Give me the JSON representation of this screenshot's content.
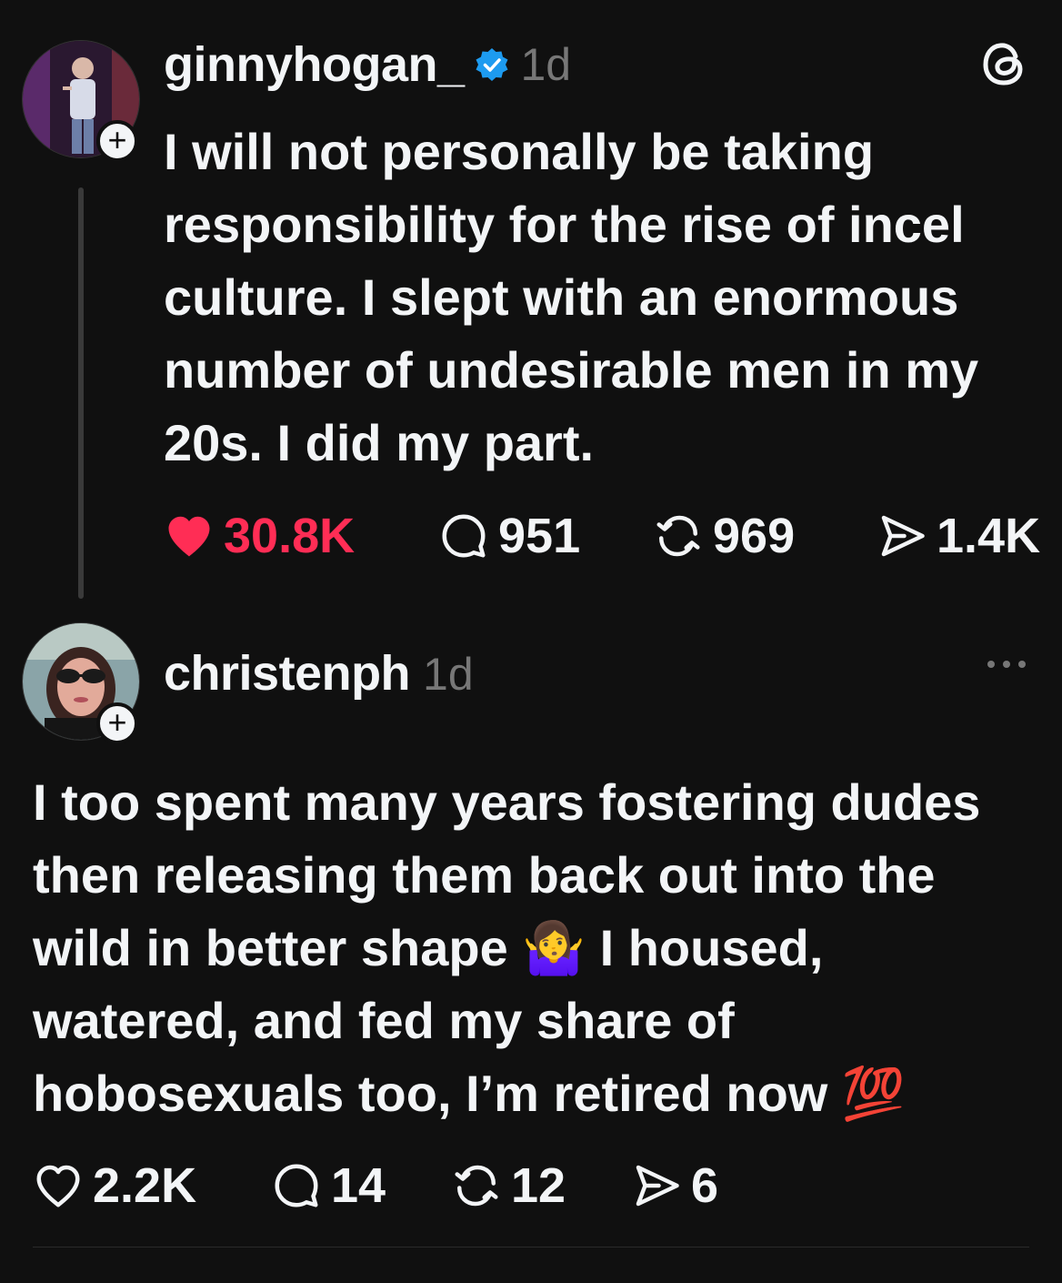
{
  "post": {
    "username": "ginnyhogan_",
    "time": "1d",
    "text": "I will not personally be taking responsibility for the rise of incel culture. I slept with an enormous number of undesirable men in my 20s. I did my part.",
    "likes": "30.8K",
    "replies": "951",
    "reposts": "969",
    "shares": "1.4K",
    "like_color": "#ff2d55"
  },
  "reply": {
    "username": "christenph",
    "time": "1d",
    "text": "I too spent many years fostering dudes then releasing them back out into the wild in better shape 🤷‍♀️ I housed, watered, and fed my share of hobosexuals too, I’m retired now 💯",
    "likes": "2.2K",
    "replies": "14",
    "reposts": "12",
    "shares": "6"
  },
  "icons": {
    "app": "threads-logo-icon",
    "verified": "verified-badge-icon",
    "more": "more-options-icon"
  }
}
